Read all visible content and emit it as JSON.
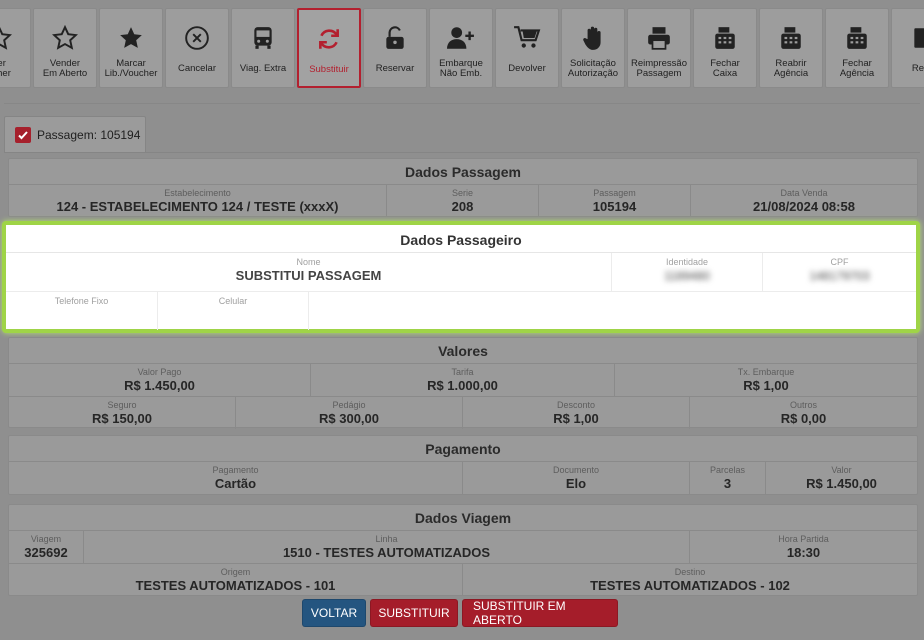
{
  "toolbar": [
    {
      "label": "der\nucher",
      "icon": "star-outline-icon"
    },
    {
      "label": "Vender\nEm Aberto",
      "icon": "star-outline-icon"
    },
    {
      "label": "Marcar\nLib./Voucher",
      "icon": "star-filled-icon"
    },
    {
      "label": "Cancelar",
      "icon": "cancel-circle-icon"
    },
    {
      "label": "Viag. Extra",
      "icon": "bus-icon"
    },
    {
      "label": "Substituir",
      "icon": "refresh-icon",
      "active": true
    },
    {
      "label": "Reservar",
      "icon": "unlock-icon"
    },
    {
      "label": "Embarque\nNão Emb.",
      "icon": "user-plus-icon"
    },
    {
      "label": "Devolver",
      "icon": "cart-icon"
    },
    {
      "label": "Solicitação\nAutorização",
      "icon": "hand-icon"
    },
    {
      "label": "Reimpressão\nPassagem",
      "icon": "printer-icon"
    },
    {
      "label": "Fechar\nCaixa",
      "icon": "cash-register-icon"
    },
    {
      "label": "Reabrir\nAgência",
      "icon": "cash-register-icon"
    },
    {
      "label": "Fechar\nAgência",
      "icon": "cash-register-icon"
    },
    {
      "label": "Relat",
      "icon": "report-icon"
    }
  ],
  "tab": {
    "label": "Passagem: 105194"
  },
  "dados_passagem": {
    "title": "Dados Passagem",
    "estabelecimento_label": "Estabelecimento",
    "estabelecimento": "124 - ESTABELECIMENTO 124 / TESTE (xxxX)",
    "serie_label": "Serie",
    "serie": "208",
    "passagem_label": "Passagem",
    "passagem": "105194",
    "data_venda_label": "Data Venda",
    "data_venda": "21/08/2024 08:58"
  },
  "dados_passageiro": {
    "title": "Dados Passageiro",
    "nome_label": "Nome",
    "nome": "SUBSTITUI PASSAGEM",
    "identidade_label": "Identidade",
    "identidade": "1189480",
    "cpf_label": "CPF",
    "cpf": "148179703",
    "telefone_label": "Telefone Fixo",
    "telefone": "",
    "celular_label": "Celular",
    "celular": ""
  },
  "valores": {
    "title": "Valores",
    "valor_pago_label": "Valor Pago",
    "valor_pago": "R$ 1.450,00",
    "tarifa_label": "Tarifa",
    "tarifa": "R$ 1.000,00",
    "tx_embarque_label": "Tx. Embarque",
    "tx_embarque": "R$ 1,00",
    "seguro_label": "Seguro",
    "seguro": "R$ 150,00",
    "pedagio_label": "Pedágio",
    "pedagio": "R$ 300,00",
    "desconto_label": "Desconto",
    "desconto": "R$ 1,00",
    "outros_label": "Outros",
    "outros": "R$ 0,00"
  },
  "pagamento": {
    "title": "Pagamento",
    "pagamento_label": "Pagamento",
    "pagamento": "Cartão",
    "documento_label": "Documento",
    "documento": "Elo",
    "parcelas_label": "Parcelas",
    "parcelas": "3",
    "valor_label": "Valor",
    "valor": "R$ 1.450,00"
  },
  "dados_viagem": {
    "title": "Dados Viagem",
    "viagem_label": "Viagem",
    "viagem": "325692",
    "linha_label": "Linha",
    "linha": "1510 - TESTES AUTOMATIZADOS",
    "hora_label": "Hora Partida",
    "hora": "18:30",
    "origem_label": "Origem",
    "origem": "TESTES AUTOMATIZADOS - 101",
    "destino_label": "Destino",
    "destino": "TESTES AUTOMATIZADOS - 102"
  },
  "buttons": {
    "voltar": "VOLTAR",
    "substituir": "SUBSTITUIR",
    "substituir_aberto": "SUBSTITUIR EM ABERTO"
  },
  "colors": {
    "accent_red": "#a51d2a",
    "blue": "#245580",
    "highlight_green": "#9fd447"
  }
}
